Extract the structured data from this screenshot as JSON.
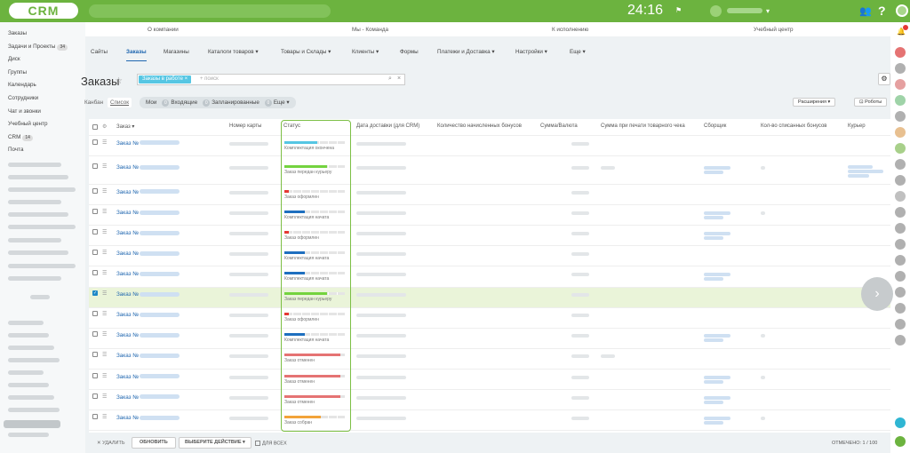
{
  "app": {
    "logo": "CRM",
    "clock": "24:16"
  },
  "topmenu": [
    "О компании",
    "Мы - Команда",
    "К исполнению",
    "Учебный центр"
  ],
  "leftnav": {
    "items": [
      {
        "label": "Заказы"
      },
      {
        "label": "Задачи и Проекты",
        "badge": "34"
      },
      {
        "label": "Диск"
      },
      {
        "label": "Группы"
      },
      {
        "label": "Календарь"
      },
      {
        "label": "Сотрудники"
      },
      {
        "label": "Чат и звонки"
      },
      {
        "label": "Учебный центр"
      },
      {
        "label": "CRM",
        "badge": "14"
      },
      {
        "label": "Почта"
      }
    ]
  },
  "tabs": [
    {
      "label": "Сайты"
    },
    {
      "label": "Заказы"
    },
    {
      "label": "Магазины"
    },
    {
      "label": "Каталоги товаров"
    },
    {
      "label": "Товары и Склады"
    },
    {
      "label": "Клиенты"
    },
    {
      "label": "Формы"
    },
    {
      "label": "Платежи и Доставка"
    },
    {
      "label": "Настройки"
    },
    {
      "label": "Еще"
    }
  ],
  "page": {
    "title": "Заказы",
    "filter_chip": "Заказы в работе",
    "filter_placeholder": "+ поиск",
    "view_kanban": "Канбан",
    "view_list": "Список",
    "presets": [
      {
        "label": "Мои",
        "count": ""
      },
      {
        "label": "Входящие",
        "count": "0"
      },
      {
        "label": "Запланированные",
        "count": "0"
      },
      {
        "label": "Еще",
        "count": "0"
      }
    ],
    "extensions": "Расширения",
    "robots": "Роботы"
  },
  "table": {
    "columns": [
      {
        "label": "Заказ"
      },
      {
        "label": "Номер карты"
      },
      {
        "label": "Статус"
      },
      {
        "label": "Дата доставки (для CRM)"
      },
      {
        "label": "Количество начисленных бонусов"
      },
      {
        "label": "Сумма/Валюта"
      },
      {
        "label": "Сумма при печати товарного чека"
      },
      {
        "label": "Сборщик"
      },
      {
        "label": "Кол-во списанных бонусов"
      },
      {
        "label": "Курьер"
      }
    ],
    "order_prefix": "Заказ №",
    "rows": [
      {
        "status": "Комплектация окончена",
        "progress": 0.55,
        "color": "#56c6e3",
        "picker": false,
        "courier": false,
        "selected": false
      },
      {
        "status": "Заказ передан курьеру",
        "progress": 0.7,
        "color": "#74d33f",
        "picker": true,
        "courier": true,
        "selected": false
      },
      {
        "status": "Заказ оформлен",
        "progress": 0.07,
        "color": "#e53935",
        "picker": false,
        "courier": false,
        "selected": false
      },
      {
        "status": "Комплектация начата",
        "progress": 0.34,
        "color": "#1e6fbf",
        "picker": true,
        "courier": false,
        "selected": false
      },
      {
        "status": "Заказ оформлен",
        "progress": 0.07,
        "color": "#e53935",
        "picker": true,
        "courier": false,
        "selected": false
      },
      {
        "status": "Комплектация начата",
        "progress": 0.34,
        "color": "#1e6fbf",
        "picker": false,
        "courier": false,
        "selected": false
      },
      {
        "status": "Комплектация начата",
        "progress": 0.34,
        "color": "#1e6fbf",
        "picker": true,
        "courier": false,
        "selected": false
      },
      {
        "status": "Заказ передан курьеру",
        "progress": 0.7,
        "color": "#74d33f",
        "picker": false,
        "courier": false,
        "selected": true
      },
      {
        "status": "Заказ оформлен",
        "progress": 0.07,
        "color": "#e53935",
        "picker": false,
        "courier": false,
        "selected": false
      },
      {
        "status": "Комплектация начата",
        "progress": 0.34,
        "color": "#1e6fbf",
        "picker": true,
        "courier": false,
        "selected": false
      },
      {
        "status": "Заказ отменен",
        "progress": 0.92,
        "color": "#e57373",
        "picker": false,
        "courier": false,
        "selected": false
      },
      {
        "status": "Заказ отменен",
        "progress": 0.92,
        "color": "#e57373",
        "picker": true,
        "courier": false,
        "selected": false
      },
      {
        "status": "Заказ отменен",
        "progress": 0.92,
        "color": "#e57373",
        "picker": true,
        "courier": false,
        "selected": false
      },
      {
        "status": "Заказ собран",
        "progress": 0.6,
        "color": "#f2a33a",
        "picker": true,
        "courier": false,
        "selected": false
      }
    ]
  },
  "footer": {
    "delete": "УДАЛИТЬ",
    "refresh": "ОБНОВИТЬ",
    "action": "ВЫБЕРИТЕ ДЕЙСТВИЕ",
    "for_all": "ДЛЯ ВСЕХ",
    "selected": "ОТМЕЧЕНО: 1 / 100"
  }
}
